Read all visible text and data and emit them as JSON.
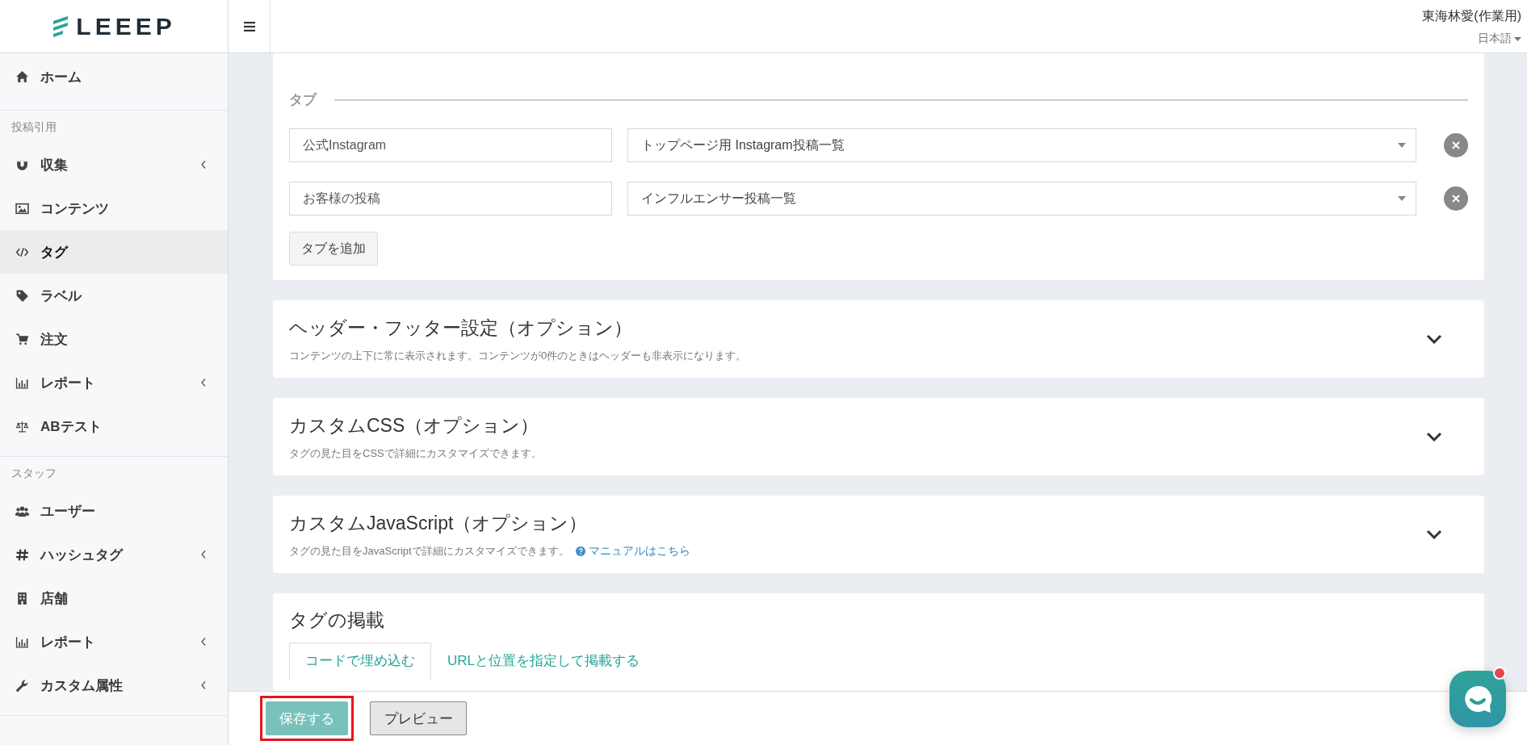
{
  "brand": {
    "name": "LEEEP"
  },
  "header": {
    "user": "東海林愛(作業用)",
    "language": "日本語"
  },
  "sidebar": {
    "sections": [
      {
        "items": [
          {
            "label": "ホーム",
            "kind": "home",
            "has_submenu": false,
            "selected": false
          }
        ]
      },
      {
        "heading": "投稿引用",
        "items": [
          {
            "label": "収集",
            "kind": "magnet",
            "has_submenu": true,
            "selected": false
          },
          {
            "label": "コンテンツ",
            "kind": "image",
            "has_submenu": false,
            "selected": false
          },
          {
            "label": "タグ",
            "kind": "code",
            "has_submenu": false,
            "selected": true
          },
          {
            "label": "ラベル",
            "kind": "tag",
            "has_submenu": false,
            "selected": false
          },
          {
            "label": "注文",
            "kind": "cart",
            "has_submenu": false,
            "selected": false
          },
          {
            "label": "レポート",
            "kind": "chart",
            "has_submenu": true,
            "selected": false
          },
          {
            "label": "ABテスト",
            "kind": "scale",
            "has_submenu": false,
            "selected": false
          }
        ]
      },
      {
        "heading": "スタッフ",
        "items": [
          {
            "label": "ユーザー",
            "kind": "users",
            "has_submenu": false,
            "selected": false
          },
          {
            "label": "ハッシュタグ",
            "kind": "hash",
            "has_submenu": true,
            "selected": false
          },
          {
            "label": "店舗",
            "kind": "building",
            "has_submenu": false,
            "selected": false
          },
          {
            "label": "レポート",
            "kind": "chart",
            "has_submenu": true,
            "selected": false
          },
          {
            "label": "カスタム属性",
            "kind": "wrench",
            "has_submenu": true,
            "selected": false
          }
        ]
      }
    ]
  },
  "tabs_section": {
    "title": "タブ",
    "rows": [
      {
        "name": "公式Instagram",
        "list": "トップページ用 Instagram投稿一覧"
      },
      {
        "name": "お客様の投稿",
        "list": "インフルエンサー投稿一覧"
      }
    ],
    "add_button": "タブを追加"
  },
  "option_panels": [
    {
      "title": "ヘッダー・フッター設定（オプション）",
      "description": "コンテンツの上下に常に表示されます。コンテンツが0件のときはヘッダーも非表示になります。",
      "expanded": false
    },
    {
      "title": "カスタムCSS（オプション）",
      "description": "タグの見た目をCSSで詳細にカスタマイズできます。",
      "expanded": false
    },
    {
      "title": "カスタムJavaScript（オプション）",
      "description": "タグの見た目をJavaScriptで詳細にカスタマイズできます。",
      "link": "マニュアルはこちら",
      "expanded": false
    }
  ],
  "embed_panel": {
    "title": "タグの掲載",
    "tabs": [
      {
        "label": "コードで埋め込む",
        "selected": true
      },
      {
        "label": "URLと位置を指定して掲載する",
        "selected": false
      }
    ]
  },
  "footer": {
    "buttons": [
      {
        "label": "保存する",
        "kind": "primary",
        "highlighted": true
      },
      {
        "label": "プレビュー",
        "kind": "secondary",
        "highlighted": false
      }
    ]
  },
  "chat": {
    "unread": true
  }
}
